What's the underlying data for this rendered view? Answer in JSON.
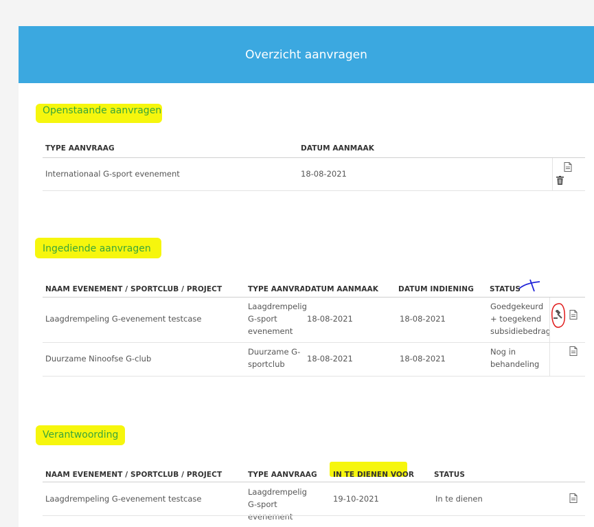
{
  "header": {
    "title": "Overzicht aanvragen"
  },
  "colors": {
    "header": "#3ba8e0",
    "section_title": "#3aa63a",
    "highlight": "#f6f60d"
  },
  "open": {
    "title": "Openstaande aanvragen",
    "columns": [
      "TYPE AANVRAAG",
      "DATUM AANMAAK"
    ],
    "rows": [
      {
        "type": "Internationaal G-sport evenement",
        "created": "18-08-2021",
        "icons": [
          "document-icon",
          "trash-icon"
        ]
      }
    ]
  },
  "submitted": {
    "title": "Ingediende aanvragen",
    "columns": [
      "NAAM EVENEMENT / SPORTCLUB / PROJECT",
      "TYPE AANVRAAG",
      "DATUM AANMAAK",
      "DATUM INDIENING",
      "STATUS"
    ],
    "rows": [
      {
        "name": "Laagdrempeling G-evenement testcase",
        "type": "Laagdrempelig G-sport evenement",
        "created": "18-08-2021",
        "submitted": "18-08-2021",
        "status": "Goedgekeurd + toegekend subsidiebedrag",
        "icons": [
          "gavel-icon",
          "document-icon"
        ]
      },
      {
        "name": "Duurzame Ninoofse G-club",
        "type": "Duurzame G-sportclub",
        "created": "18-08-2021",
        "submitted": "18-08-2021",
        "status": "Nog in behandeling",
        "icons": [
          "document-icon"
        ]
      }
    ]
  },
  "justification": {
    "title": "Verantwoording",
    "columns": [
      "NAAM EVENEMENT / SPORTCLUB / PROJECT",
      "TYPE AANVRAAG",
      "IN TE DIENEN VOOR",
      "STATUS"
    ],
    "rows": [
      {
        "name": "Laagdrempeling G-evenement testcase",
        "type": "Laagdrempelig G-sport evenement",
        "due": "19-10-2021",
        "status": "In te dienen",
        "icons": [
          "document-icon"
        ]
      }
    ]
  }
}
